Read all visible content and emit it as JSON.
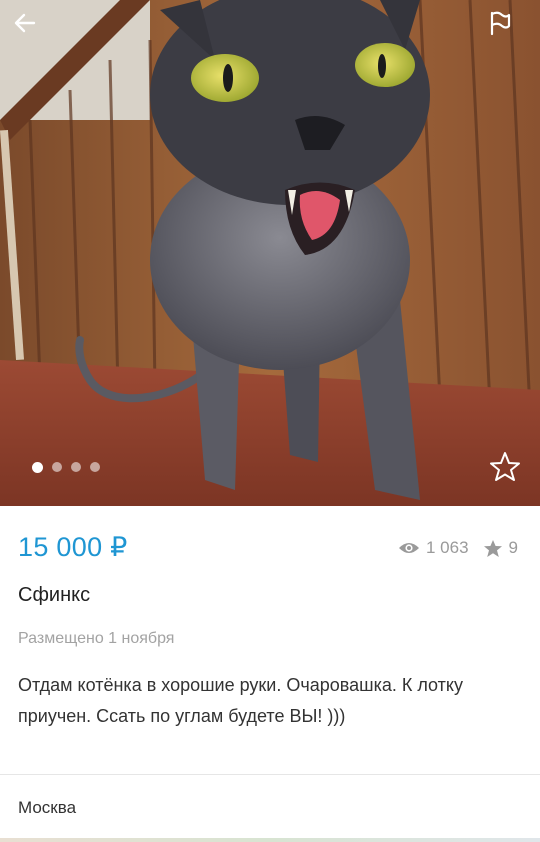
{
  "listing": {
    "price": "15 000 ₽",
    "views": "1 063",
    "favorites": "9",
    "title": "Сфинкс",
    "posted": "Размещено 1 ноября",
    "description": "Отдам котёнка в хорошие руки. Очаровашка. К лотку приучен. Ссать по углам будете ВЫ! )))",
    "city": "Москва"
  },
  "gallery": {
    "image_count": 4,
    "active_index": 0
  },
  "icons": {
    "back": "back-arrow-icon",
    "report": "flag-icon",
    "favorite": "star-outline-icon",
    "views": "eye-icon",
    "favorites": "star-filled-icon"
  },
  "colors": {
    "price": "#1f96d3",
    "muted": "#9a9a9a"
  }
}
